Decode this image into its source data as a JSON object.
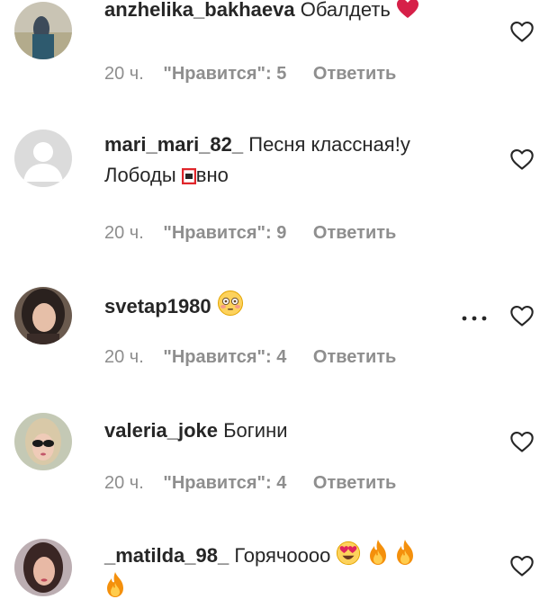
{
  "comments": [
    {
      "username": "anzhelika_bakhaeva",
      "text": "Обалдеть",
      "time": "20 ч.",
      "likes": "\"Нравится\": 5",
      "reply": "Ответить"
    },
    {
      "username": "mari_mari_82_",
      "text_part1": "Песня классная!у",
      "text_part2": "Лободы ",
      "text_part3": "вно",
      "time": "20 ч.",
      "likes": "\"Нравится\": 9",
      "reply": "Ответить"
    },
    {
      "username": "svetap1980",
      "text": "",
      "time": "20 ч.",
      "likes": "\"Нравится\": 4",
      "reply": "Ответить"
    },
    {
      "username": "valeria_joke",
      "text": "Богини",
      "time": "20 ч.",
      "likes": "\"Нравится\": 4",
      "reply": "Ответить"
    },
    {
      "username": "_matilda_98_",
      "text": "Горячоооо",
      "time": "",
      "likes": "",
      "reply": ""
    }
  ],
  "icons": {
    "like": "heart-outline-icon",
    "more": "more-options-icon"
  },
  "colors": {
    "text": "#262626",
    "meta": "#8e8e8e",
    "heart_emoji": "#e0245e",
    "fire": "#f4900c"
  }
}
